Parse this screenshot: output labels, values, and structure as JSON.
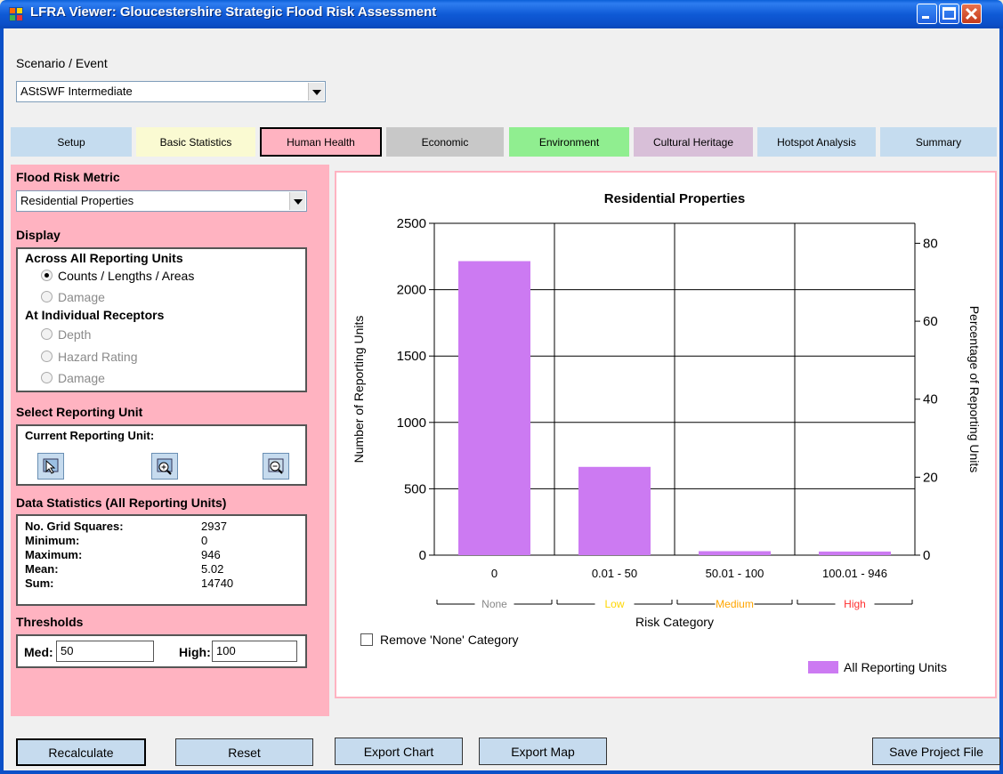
{
  "window": {
    "title": "LFRA Viewer: Gloucestershire Strategic Flood Risk Assessment"
  },
  "scenario": {
    "label": "Scenario / Event",
    "value": "AStSWF Intermediate"
  },
  "tabs": [
    {
      "label": "Setup",
      "color": "#c5dcef"
    },
    {
      "label": "Basic Statistics",
      "color": "#fafad2"
    },
    {
      "label": "Human Health",
      "color": "#ffb3c1"
    },
    {
      "label": "Economic",
      "color": "#c8c8c8"
    },
    {
      "label": "Environment",
      "color": "#90ee90"
    },
    {
      "label": "Cultural Heritage",
      "color": "#d8bfd8"
    },
    {
      "label": "Hotspot Analysis",
      "color": "#c5dcef"
    },
    {
      "label": "Summary",
      "color": "#c5dcef"
    }
  ],
  "left": {
    "metric_title": "Flood Risk Metric",
    "metric_value": "Residential Properties",
    "display_title": "Display",
    "across_title": "Across All Reporting Units",
    "across_options": [
      "Counts / Lengths / Areas",
      "Damage"
    ],
    "individual_title": "At Individual Receptors",
    "individual_options": [
      "Depth",
      "Hazard Rating",
      "Damage"
    ],
    "select_title": "Select Reporting Unit",
    "current_unit_label": "Current Reporting Unit:",
    "stats_title": "Data Statistics (All Reporting Units)",
    "stats": [
      {
        "key": "No. Grid Squares:",
        "value": "2937"
      },
      {
        "key": "Minimum:",
        "value": "0"
      },
      {
        "key": "Maximum:",
        "value": "946"
      },
      {
        "key": "Mean:",
        "value": "5.02"
      },
      {
        "key": "Sum:",
        "value": "14740"
      }
    ],
    "thresholds_title": "Thresholds",
    "med_label": "Med:",
    "med_value": "50",
    "high_label": "High:",
    "high_value": "100"
  },
  "chart_data": {
    "type": "bar",
    "title": "Residential Properties",
    "categories": [
      "0",
      "0.01 - 50",
      "50.01 - 100",
      "100.01 - 946"
    ],
    "values": [
      2215,
      665,
      30,
      27
    ],
    "series": [
      {
        "name": "All Reporting Units",
        "values": [
          2215,
          665,
          30,
          27
        ],
        "color": "#cc7af2"
      }
    ],
    "ylabel": "Number of Reporting Units",
    "y2label": "Percentage of Reporting Units",
    "xlabel": "Risk Category",
    "ylim": [
      0,
      2500
    ],
    "yticks": [
      "0",
      "500",
      "1000",
      "1500",
      "2000",
      "2500"
    ],
    "y2ticks": [
      "0",
      "20",
      "40",
      "60",
      "80"
    ],
    "risk_bands": [
      {
        "label": "None",
        "color": "#888888"
      },
      {
        "label": "Low",
        "color": "#ffd700"
      },
      {
        "label": "Medium",
        "color": "#ffa500"
      },
      {
        "label": "High",
        "color": "#ff3030"
      }
    ],
    "grid": true,
    "legend": "bottom-right"
  },
  "chart_options": {
    "remove_none_label": "Remove 'None' Category"
  },
  "buttons": {
    "recalculate": "Recalculate",
    "reset": "Reset",
    "export_chart": "Export Chart",
    "export_map": "Export Map",
    "save_project": "Save Project File"
  }
}
